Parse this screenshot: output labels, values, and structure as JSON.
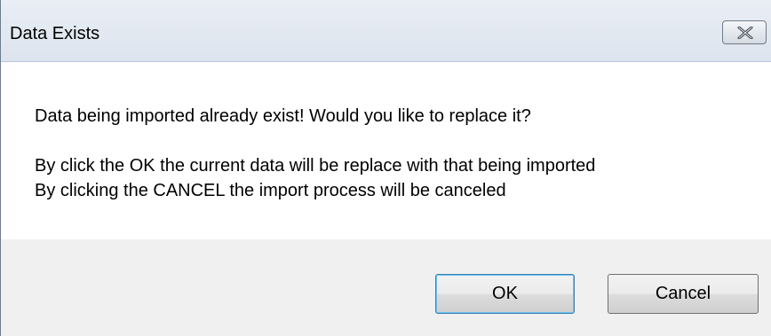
{
  "window": {
    "title": "Data Exists"
  },
  "titlebar": {
    "close_icon": "close-x-icon"
  },
  "message": {
    "question": "Data being imported already exist! Would you like to replace it?",
    "ok_explanation": "By click the OK the current data will be replace with that being imported",
    "cancel_explanation": "By clicking the CANCEL the import process will be canceled"
  },
  "buttons": {
    "ok_label": "OK",
    "cancel_label": "Cancel"
  }
}
